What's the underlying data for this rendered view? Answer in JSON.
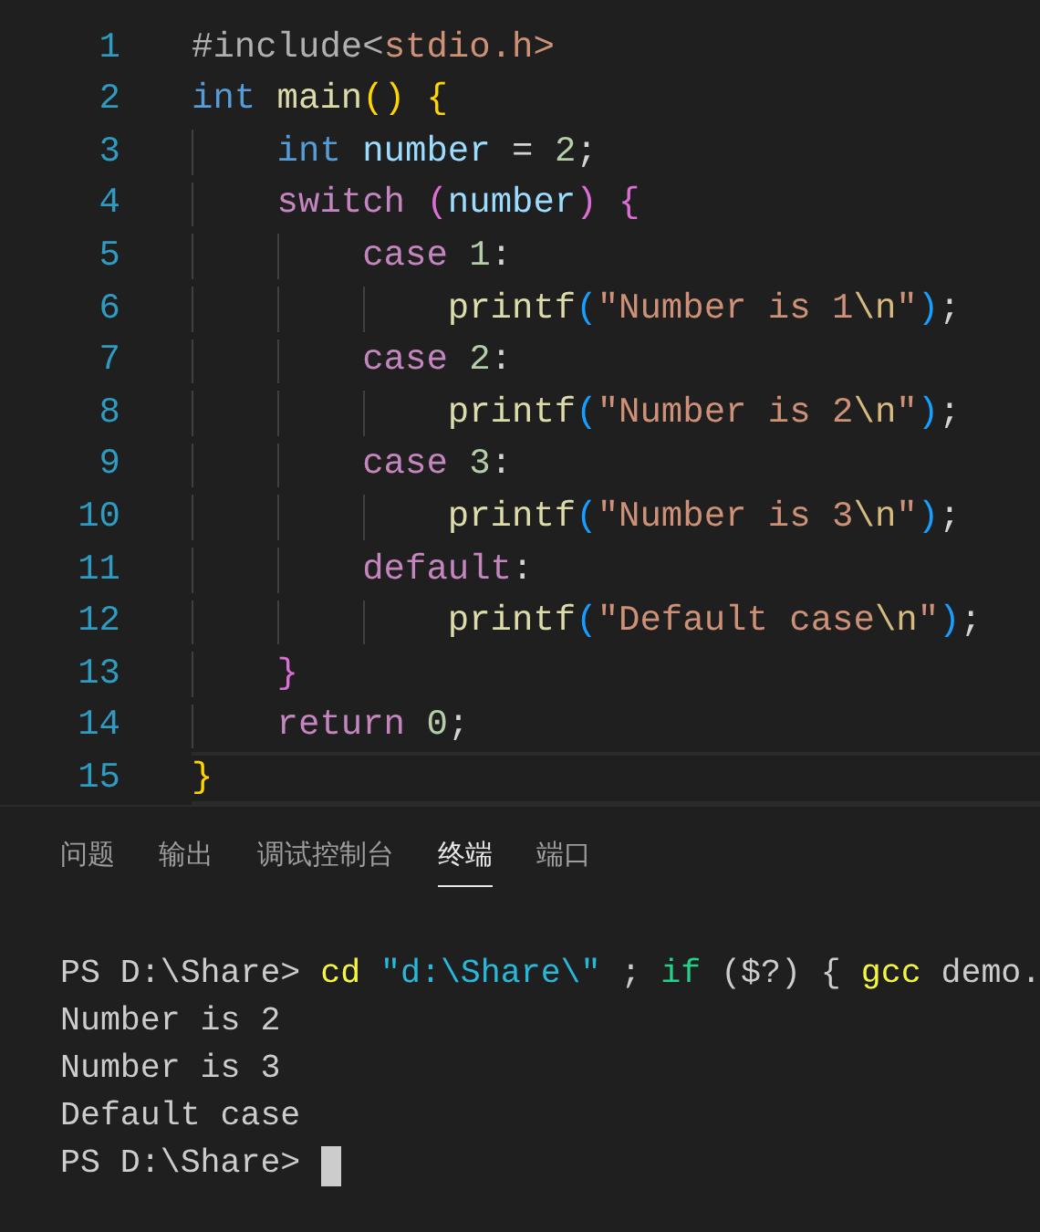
{
  "editor": {
    "lines": [
      {
        "number": "1",
        "current": false,
        "tokens": [
          {
            "kind": "preproc",
            "text": "#include"
          },
          {
            "kind": "preproc",
            "text": "<"
          },
          {
            "kind": "string",
            "text": "stdio.h>"
          }
        ]
      },
      {
        "number": "2",
        "current": false,
        "tokens": [
          {
            "kind": "keyword",
            "text": "int"
          },
          {
            "kind": "function",
            "text": " main"
          },
          {
            "kind": "bracket1",
            "text": "()"
          },
          {
            "kind": "bracket1",
            "text": " {"
          }
        ]
      },
      {
        "number": "3",
        "current": false,
        "tokens": [
          {
            "kind": "keyword",
            "text": "    int"
          },
          {
            "kind": "variable",
            "text": " number"
          },
          {
            "kind": "plain",
            "text": " = "
          },
          {
            "kind": "number",
            "text": "2"
          },
          {
            "kind": "plain",
            "text": ";"
          }
        ]
      },
      {
        "number": "4",
        "current": false,
        "tokens": [
          {
            "kind": "control",
            "text": "    switch"
          },
          {
            "kind": "bracket2",
            "text": " ("
          },
          {
            "kind": "variable",
            "text": "number"
          },
          {
            "kind": "bracket2",
            "text": ")"
          },
          {
            "kind": "bracket2",
            "text": " {"
          }
        ]
      },
      {
        "number": "5",
        "current": false,
        "tokens": [
          {
            "kind": "control",
            "text": "        case"
          },
          {
            "kind": "number",
            "text": " 1"
          },
          {
            "kind": "plain",
            "text": ":"
          }
        ]
      },
      {
        "number": "6",
        "current": false,
        "tokens": [
          {
            "kind": "function",
            "text": "            printf"
          },
          {
            "kind": "bracket3",
            "text": "("
          },
          {
            "kind": "string",
            "text": "\"Number is 1"
          },
          {
            "kind": "escape",
            "text": "\\n"
          },
          {
            "kind": "string",
            "text": "\""
          },
          {
            "kind": "bracket3",
            "text": ")"
          },
          {
            "kind": "plain",
            "text": ";"
          }
        ]
      },
      {
        "number": "7",
        "current": false,
        "tokens": [
          {
            "kind": "control",
            "text": "        case"
          },
          {
            "kind": "number",
            "text": " 2"
          },
          {
            "kind": "plain",
            "text": ":"
          }
        ]
      },
      {
        "number": "8",
        "current": false,
        "tokens": [
          {
            "kind": "function",
            "text": "            printf"
          },
          {
            "kind": "bracket3",
            "text": "("
          },
          {
            "kind": "string",
            "text": "\"Number is 2"
          },
          {
            "kind": "escape",
            "text": "\\n"
          },
          {
            "kind": "string",
            "text": "\""
          },
          {
            "kind": "bracket3",
            "text": ")"
          },
          {
            "kind": "plain",
            "text": ";"
          }
        ]
      },
      {
        "number": "9",
        "current": false,
        "tokens": [
          {
            "kind": "control",
            "text": "        case"
          },
          {
            "kind": "number",
            "text": " 3"
          },
          {
            "kind": "plain",
            "text": ":"
          }
        ]
      },
      {
        "number": "10",
        "current": false,
        "tokens": [
          {
            "kind": "function",
            "text": "            printf"
          },
          {
            "kind": "bracket3",
            "text": "("
          },
          {
            "kind": "string",
            "text": "\"Number is 3"
          },
          {
            "kind": "escape",
            "text": "\\n"
          },
          {
            "kind": "string",
            "text": "\""
          },
          {
            "kind": "bracket3",
            "text": ")"
          },
          {
            "kind": "plain",
            "text": ";"
          }
        ]
      },
      {
        "number": "11",
        "current": false,
        "tokens": [
          {
            "kind": "control",
            "text": "        default"
          },
          {
            "kind": "plain",
            "text": ":"
          }
        ]
      },
      {
        "number": "12",
        "current": false,
        "tokens": [
          {
            "kind": "function",
            "text": "            printf"
          },
          {
            "kind": "bracket3",
            "text": "("
          },
          {
            "kind": "string",
            "text": "\"Default case"
          },
          {
            "kind": "escape",
            "text": "\\n"
          },
          {
            "kind": "string",
            "text": "\""
          },
          {
            "kind": "bracket3",
            "text": ")"
          },
          {
            "kind": "plain",
            "text": ";"
          }
        ]
      },
      {
        "number": "13",
        "current": false,
        "tokens": [
          {
            "kind": "bracket2",
            "text": "    }"
          }
        ]
      },
      {
        "number": "14",
        "current": false,
        "tokens": [
          {
            "kind": "control",
            "text": "    return"
          },
          {
            "kind": "number",
            "text": " 0"
          },
          {
            "kind": "plain",
            "text": ";"
          }
        ]
      },
      {
        "number": "15",
        "current": true,
        "tokens": [
          {
            "kind": "bracket1",
            "text": "}"
          }
        ]
      }
    ]
  },
  "panel": {
    "tabs": [
      {
        "label": "问题",
        "selected": false
      },
      {
        "label": "输出",
        "selected": false
      },
      {
        "label": "调试控制台",
        "selected": false
      },
      {
        "label": "终端",
        "selected": true
      },
      {
        "label": "端口",
        "selected": false
      }
    ],
    "terminal": {
      "lines": [
        {
          "cursor": false,
          "tokens": [
            {
              "kind": "plain",
              "text": "PS D:\\Share> "
            },
            {
              "kind": "command",
              "text": "cd"
            },
            {
              "kind": "string",
              "text": " \"d:\\Share\\\""
            },
            {
              "kind": "plain",
              "text": " ; "
            },
            {
              "kind": "keyword",
              "text": "if"
            },
            {
              "kind": "plain",
              "text": " ($?) { "
            },
            {
              "kind": "command",
              "text": "gcc"
            },
            {
              "kind": "plain",
              "text": " demo."
            }
          ]
        },
        {
          "cursor": false,
          "tokens": [
            {
              "kind": "plain",
              "text": "Number is 2"
            }
          ]
        },
        {
          "cursor": false,
          "tokens": [
            {
              "kind": "plain",
              "text": "Number is 3"
            }
          ]
        },
        {
          "cursor": false,
          "tokens": [
            {
              "kind": "plain",
              "text": "Default case"
            }
          ]
        },
        {
          "cursor": true,
          "tokens": [
            {
              "kind": "plain",
              "text": "PS D:\\Share> "
            }
          ]
        }
      ]
    }
  }
}
